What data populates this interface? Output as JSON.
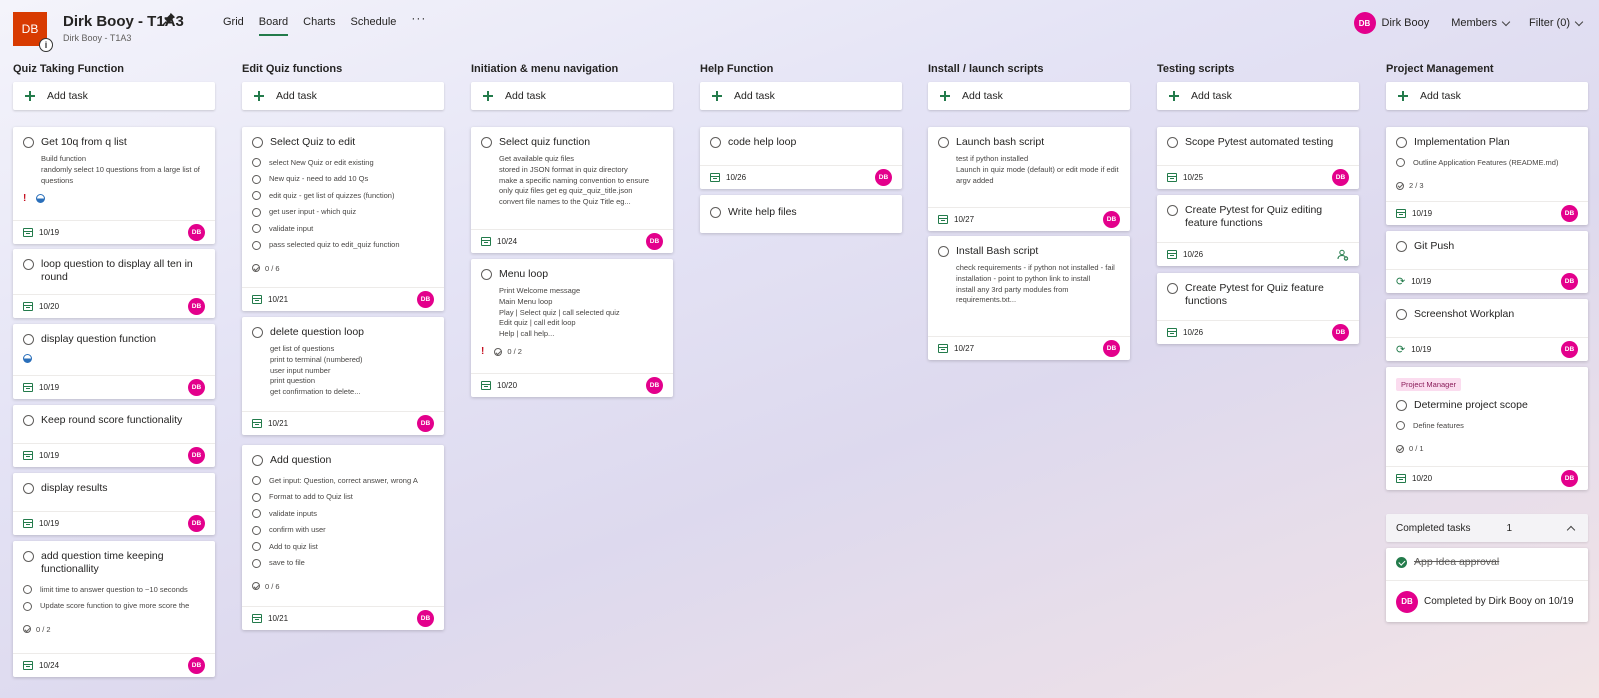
{
  "header": {
    "plan_initials": "DB",
    "plan_title": "Dirk Booy - T1A3",
    "plan_subtitle": "Dirk Booy - T1A3",
    "tabs": [
      "Grid",
      "Board",
      "Charts",
      "Schedule"
    ],
    "more_label": "···",
    "user_name": "Dirk Booy",
    "members_label": "Members",
    "filter_label": "Filter (0)"
  },
  "add_task_label": "Add task",
  "avatar_initials": "DB",
  "columns": [
    {
      "title": "Quiz Taking Function",
      "cards": [
        {
          "title": "Get 10q from q list",
          "desc": "Build function\nrandomly select 10 questions from a large list of questions",
          "due": "10/19"
        },
        {
          "title": "loop question to display all ten in round",
          "due": "10/20"
        },
        {
          "title": "display question function",
          "due": "10/19"
        },
        {
          "title": "Keep round score functionality",
          "due": "10/19"
        },
        {
          "title": "display results",
          "due": "10/19"
        },
        {
          "title": "add question time keeping functionallity",
          "checklist": [
            "limit time to answer question to ~10 seconds",
            "Update score function to give more score the"
          ],
          "progress": "0 / 2",
          "due": "10/24"
        }
      ]
    },
    {
      "title": "Edit Quiz functions",
      "cards": [
        {
          "title": "Select Quiz to edit",
          "checklist": [
            "select New Quiz or edit existing",
            "New quiz - need to add 10 Qs",
            "edit quiz - get list of quizzes (function)",
            "get user input - which quiz",
            "validate input",
            "pass selected quiz to edit_quiz function"
          ],
          "progress": "0 / 6",
          "due": "10/21"
        },
        {
          "title": "delete question loop",
          "desc": "get list of questions\nprint to terminal (numbered)\nuser input number\nprint question\nget confirmation to delete...",
          "due": "10/21"
        },
        {
          "title": "Add question",
          "checklist": [
            "Get input: Question, correct answer, wrong A",
            "Format to add to Quiz list",
            "validate inputs",
            "confirm with user",
            "Add to quiz list",
            "save to file"
          ],
          "progress": "0 / 6",
          "due": "10/21"
        }
      ]
    },
    {
      "title": "Initiation & menu navigation",
      "cards": [
        {
          "title": "Select quiz function",
          "desc": "Get available quiz files\nstored in JSON format in quiz directory\nmake a specific naming convention to ensure only quiz files get eg quiz_quiz_title.json\nconvert file names to the Quiz Title eg...",
          "due": "10/24"
        },
        {
          "title": "Menu loop",
          "desc": "Print Welcome message\nMain Menu loop\nPlay | Select quiz | call selected quiz\nEdit quiz | call edit loop\nHelp | call help...",
          "progress": "0 / 2",
          "due": "10/20"
        }
      ]
    },
    {
      "title": "Help Function",
      "cards": [
        {
          "title": "code help loop",
          "due": "10/26"
        },
        {
          "title": "Write help files"
        }
      ]
    },
    {
      "title": "Install / launch scripts",
      "cards": [
        {
          "title": "Launch bash script",
          "desc": "test if python installed\nLaunch in quiz mode (default) or edit mode if edit argv added",
          "due": "10/27"
        },
        {
          "title": "Install Bash script",
          "desc": "check requirements - if python not installed - fail installation - point to python link to install\ninstall any 3rd party modules from requirements.txt...",
          "due": "10/27"
        }
      ]
    },
    {
      "title": "Testing scripts",
      "cards": [
        {
          "title": "Scope Pytest automated testing",
          "due": "10/25"
        },
        {
          "title": "Create Pytest for Quiz editing feature functions",
          "due": "10/26"
        },
        {
          "title": "Create Pytest for Quiz feature functions",
          "due": "10/26"
        }
      ]
    },
    {
      "title": "Project Management",
      "cards": [
        {
          "title": "Implementation Plan",
          "checklist": [
            "Outline Application Features (README.md)"
          ],
          "progress": "2 / 3",
          "due": "10/19"
        },
        {
          "title": "Git Push",
          "due": "10/19"
        },
        {
          "title": "Screenshot Workplan",
          "due": "10/19"
        },
        {
          "label": "Project Manager",
          "title": "Determine project scope",
          "checklist": [
            "Define features"
          ],
          "progress": "0 / 1",
          "due": "10/20"
        }
      ],
      "completed": {
        "label": "Completed tasks",
        "count": "1",
        "task": "App Idea approval",
        "completed_by": "Completed by Dirk Booy on 10/19"
      }
    }
  ],
  "colors": {
    "accent": "#237b4b",
    "plan_icon": "#d83b01",
    "avatar": "#e3008c",
    "urgent": "#c50f1f",
    "label_pill": "#fbdcef"
  }
}
